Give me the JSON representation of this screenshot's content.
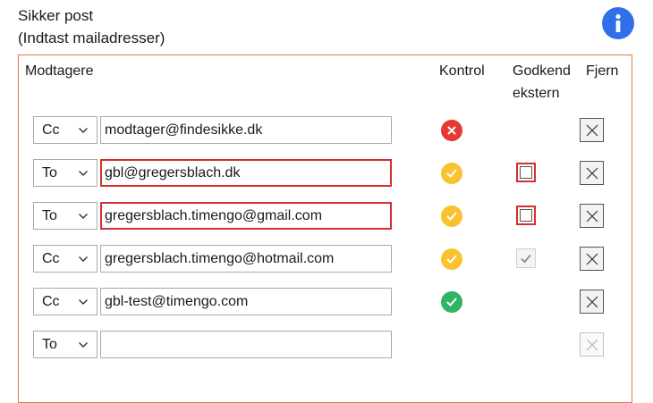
{
  "title": {
    "line1": "Sikker post",
    "line2": "(Indtast mailadresser)"
  },
  "info_icon": "info-icon",
  "headers": {
    "recipients": "Modtagere",
    "control": "Kontrol",
    "approve_line1": "Godkend",
    "approve_line2": "ekstern",
    "remove": "Fjern"
  },
  "colors": {
    "accent_border": "#e07a45",
    "error": "#e53935",
    "warning": "#f9c22e",
    "ok": "#2fb464",
    "info": "#2f6fea"
  },
  "rows": [
    {
      "type": "Cc",
      "email": "modtager@findesikke.dk",
      "status": "error",
      "approve": "none",
      "remove_enabled": true
    },
    {
      "type": "To",
      "email": "gbl@gregersblach.dk",
      "status": "warning",
      "approve": "unchecked-error",
      "email_error": true,
      "remove_enabled": true
    },
    {
      "type": "To",
      "email": "gregersblach.timengo@gmail.com",
      "status": "warning",
      "approve": "unchecked-error",
      "email_error": true,
      "remove_enabled": true
    },
    {
      "type": "Cc",
      "email": "gregersblach.timengo@hotmail.com",
      "status": "warning",
      "approve": "checked-disabled",
      "remove_enabled": true
    },
    {
      "type": "Cc",
      "email": "gbl-test@timengo.com",
      "status": "ok",
      "approve": "none",
      "remove_enabled": true
    },
    {
      "type": "To",
      "email": "",
      "status": "none",
      "approve": "none",
      "remove_enabled": false
    }
  ]
}
